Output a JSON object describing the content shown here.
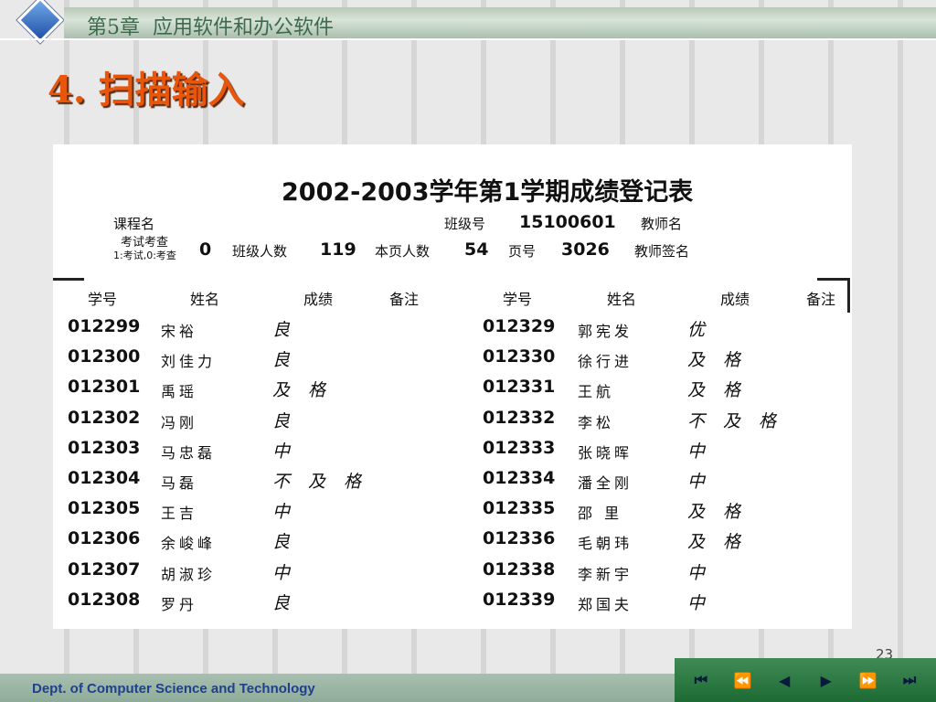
{
  "header": {
    "chapter_title": "第5章  应用软件和办公软件"
  },
  "slide": {
    "heading": "4. 扫描输入"
  },
  "scan": {
    "title": "2002-2003学年第1学期成绩登记表",
    "course_label": "课程名",
    "class_no_label": "班级号",
    "class_no": "15100601",
    "teacher_label": "教师名",
    "exam_type_label": "考试考查",
    "exam_type_note": "1:考试,0:考查",
    "exam_type_value": "0",
    "class_size_label": "班级人数",
    "class_size": "119",
    "page_count_label": "本页人数",
    "page_count": "54",
    "page_no_label": "页号",
    "page_no": "3026",
    "teacher_sign_label": "教师签名",
    "columns_left": [
      "学号",
      "姓名",
      "成绩",
      "备注"
    ],
    "columns_right": [
      "学号",
      "姓名",
      "成绩",
      "备注"
    ],
    "rows": [
      {
        "l_id": "012299",
        "l_name": "宋裕",
        "l_grade": "良",
        "r_id": "012329",
        "r_name": "郭宪发",
        "r_grade": "优"
      },
      {
        "l_id": "012300",
        "l_name": "刘佳力",
        "l_grade": "良",
        "r_id": "012330",
        "r_name": "徐行进",
        "r_grade": "及格"
      },
      {
        "l_id": "012301",
        "l_name": "禹瑶",
        "l_grade": "及格",
        "r_id": "012331",
        "r_name": "王航",
        "r_grade": "及格"
      },
      {
        "l_id": "012302",
        "l_name": "冯刚",
        "l_grade": "良",
        "r_id": "012332",
        "r_name": "李松",
        "r_grade": "不及格"
      },
      {
        "l_id": "012303",
        "l_name": "马忠磊",
        "l_grade": "中",
        "r_id": "012333",
        "r_name": "张晓晖",
        "r_grade": "中"
      },
      {
        "l_id": "012304",
        "l_name": "马磊",
        "l_grade": "不及格",
        "r_id": "012334",
        "r_name": "潘全刚",
        "r_grade": "中"
      },
      {
        "l_id": "012305",
        "l_name": "王吉",
        "l_grade": "中",
        "r_id": "012335",
        "r_name": "邵 里",
        "r_grade": "及格"
      },
      {
        "l_id": "012306",
        "l_name": "余峻峰",
        "l_grade": "良",
        "r_id": "012336",
        "r_name": "毛朝玮",
        "r_grade": "及格"
      },
      {
        "l_id": "012307",
        "l_name": "胡淑珍",
        "l_grade": "中",
        "r_id": "012338",
        "r_name": "李新宇",
        "r_grade": "中"
      },
      {
        "l_id": "012308",
        "l_name": "罗丹",
        "l_grade": "良",
        "r_id": "012339",
        "r_name": "郑国夫",
        "r_grade": "中"
      }
    ]
  },
  "footer": {
    "department": "Dept. of Computer Science and Technology",
    "page_number": "23"
  },
  "nav": {
    "first": "⏮",
    "prev_section": "⏪",
    "prev": "◀",
    "next": "▶",
    "next_section": "⏩",
    "last": "⏭"
  }
}
